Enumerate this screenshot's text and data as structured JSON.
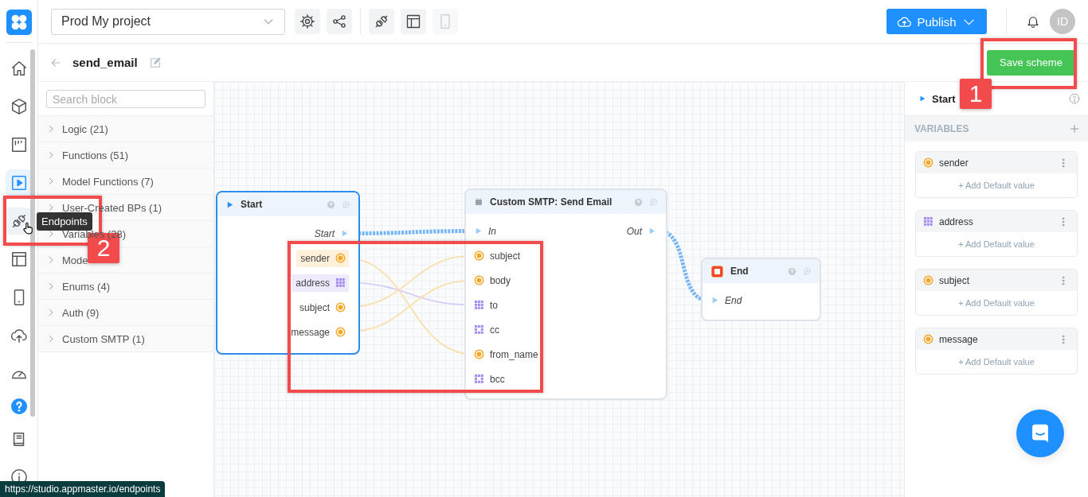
{
  "rail": {
    "items": [
      {
        "kind": "home",
        "selected": false,
        "hovered": false
      },
      {
        "kind": "cube",
        "selected": false,
        "hovered": false
      },
      {
        "kind": "board",
        "selected": false,
        "hovered": false
      },
      {
        "kind": "play",
        "selected": true,
        "hovered": false
      },
      {
        "kind": "plug",
        "selected": false,
        "hovered": true
      },
      {
        "kind": "layout",
        "selected": false,
        "hovered": false
      },
      {
        "kind": "mobile",
        "selected": false,
        "hovered": false
      },
      {
        "kind": "upload",
        "selected": false,
        "hovered": false
      },
      {
        "kind": "gauge",
        "selected": false,
        "hovered": false
      },
      {
        "kind": "help",
        "selected": false,
        "hovered": false
      },
      {
        "kind": "book",
        "selected": false,
        "hovered": false
      },
      {
        "kind": "info",
        "selected": false,
        "hovered": false
      }
    ]
  },
  "topbar": {
    "project": "Prod My project",
    "tools": [
      {
        "kind": "gear",
        "disabled": false
      },
      {
        "kind": "share",
        "disabled": false
      },
      {
        "kind": "plug",
        "disabled": false
      },
      {
        "kind": "layout",
        "disabled": false
      },
      {
        "kind": "mobile",
        "disabled": true
      }
    ],
    "publish": "Publish",
    "avatar": "ID"
  },
  "header": {
    "title": "send_email",
    "save": "Save scheme"
  },
  "blocks": {
    "placeholder": "Search block",
    "groups": [
      "Logic (21)",
      "Functions (51)",
      "Model Functions (7)",
      "User-Created BPs (1)",
      "Variables (28)",
      "Mode",
      "Enums (4)",
      "Auth (9)",
      "Custom SMTP (1)"
    ]
  },
  "canvas": {
    "nodes": [
      {
        "kind": "start",
        "title": "Start",
        "selected": true,
        "exec_outputs": [
          "Start"
        ],
        "outputs": [
          {
            "name": "sender",
            "kind": "circle",
            "highlighted": true
          },
          {
            "name": "address",
            "kind": "grid",
            "highlighted": true
          },
          {
            "name": "subject",
            "kind": "circle",
            "highlighted": false
          },
          {
            "name": "message",
            "kind": "circle",
            "highlighted": false
          }
        ]
      },
      {
        "kind": "function",
        "title": "Custom SMTP: Send Email",
        "selected": false,
        "exec_inputs": [
          "In"
        ],
        "exec_outputs": [
          "Out"
        ],
        "inputs": [
          {
            "name": "subject",
            "kind": "circle"
          },
          {
            "name": "body",
            "kind": "circle"
          },
          {
            "name": "to",
            "kind": "grid"
          },
          {
            "name": "cc",
            "kind": "dotted"
          },
          {
            "name": "from_name",
            "kind": "circle"
          },
          {
            "name": "bcc",
            "kind": "dotted"
          }
        ]
      },
      {
        "kind": "end",
        "title": "End",
        "selected": false,
        "exec_inputs": [
          "End"
        ]
      }
    ]
  },
  "inspector": {
    "title": "Start",
    "section": "VARIABLES",
    "variables": [
      {
        "name": "sender",
        "kind": "circle",
        "action": "+ Add Default value"
      },
      {
        "name": "address",
        "kind": "grid",
        "action": "+ Add Default value"
      },
      {
        "name": "subject",
        "kind": "circle",
        "action": "+ Add Default value"
      },
      {
        "name": "message",
        "kind": "circle",
        "action": "+ Add Default value"
      }
    ]
  },
  "tooltip": "Endpoints",
  "annotations": [
    "1",
    "2"
  ],
  "status_url": "https://studio.appmaster.io/endpoints"
}
